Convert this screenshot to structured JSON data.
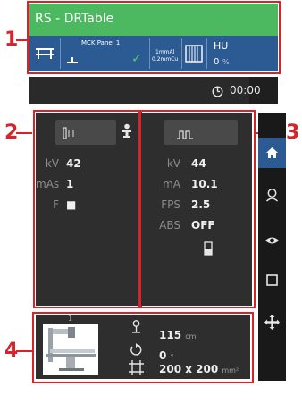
{
  "header": {
    "title": "RS - DRTable",
    "panel_label": "MCK Panel 1",
    "filter_line1": "1mmAl",
    "filter_line2": "0.2mmCu",
    "hu_label": "HU",
    "hu_value": "0",
    "hu_unit": "%"
  },
  "timer": {
    "time": "00:00"
  },
  "callouts": {
    "c1": "1",
    "c2": "2",
    "c3": "3",
    "c4": "4"
  },
  "left_panel": {
    "rows": [
      {
        "label": "kV",
        "value": "42"
      },
      {
        "label": "mAs",
        "value": "1"
      },
      {
        "label": "F",
        "value": "■"
      }
    ]
  },
  "right_panel": {
    "rows": [
      {
        "label": "kV",
        "value": "44"
      },
      {
        "label": "mA",
        "value": "10.1"
      },
      {
        "label": "FPS",
        "value": "2.5"
      },
      {
        "label": "ABS",
        "value": "OFF"
      }
    ]
  },
  "bottom": {
    "thumb_number": "1",
    "distance_value": "115",
    "distance_unit": "cm",
    "angle_value": "0",
    "angle_unit": "°",
    "field_value": "200 x 200",
    "field_unit": "mm²"
  },
  "colors": {
    "callout_red": "#d8232a",
    "title_green": "#4cb860",
    "header_blue": "#2c5a93",
    "panel_dark": "#2e2e2e"
  }
}
